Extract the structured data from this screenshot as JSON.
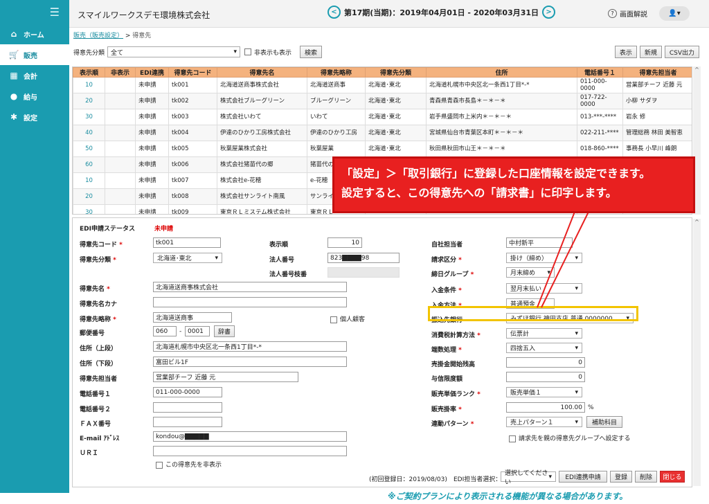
{
  "header": {
    "company": "スマイルワークスデモ環境株式会社",
    "period": "第17期(当期)：2019年04月01日 - 2020年03月31日",
    "help": "画面解説",
    "prev": "<",
    "next": ">"
  },
  "sidebar": {
    "items": [
      {
        "label": "ホーム",
        "icon": "home-icon"
      },
      {
        "label": "販売",
        "icon": "cart-icon"
      },
      {
        "label": "会計",
        "icon": "calculator-icon"
      },
      {
        "label": "給与",
        "icon": "moneybag-icon"
      },
      {
        "label": "設定",
        "icon": "gear-icon"
      }
    ]
  },
  "breadcrumb": {
    "parent": "販売（販売設定）",
    "current": "得意先"
  },
  "toolbar": {
    "category_label": "得意先分類",
    "category_value": "全て",
    "show_hidden": "非表示も表示",
    "search": "検索",
    "display": "表示",
    "new": "新規",
    "csv": "CSV出力"
  },
  "table": {
    "headers": [
      "表示順",
      "非表示",
      "EDI連携",
      "得意先コード",
      "得意先名",
      "得意先略称",
      "得意先分類",
      "住所",
      "電話番号１",
      "得意先担当者"
    ],
    "rows": [
      [
        "10",
        "",
        "未申請",
        "tk001",
        "北海道送商事株式会社",
        "北海道送商事",
        "北海道･東北",
        "北海道札幌市中央区北一条西1丁目*-*",
        "011-000-0000",
        "営業部チーフ 近藤 元"
      ],
      [
        "20",
        "",
        "未申請",
        "tk002",
        "株式会社ブルーグリーン",
        "ブルーグリーン",
        "北海道･東北",
        "青森県青森市長島＊－＊－＊",
        "017-722-0000",
        "小柳 サダヲ"
      ],
      [
        "30",
        "",
        "未申請",
        "tk003",
        "株式会社いわて",
        "いわて",
        "北海道･東北",
        "岩手県盛岡市上米内＊－＊－＊",
        "013-***-****",
        "岩永 修"
      ],
      [
        "40",
        "",
        "未申請",
        "tk004",
        "伊達のひかり工房株式会社",
        "伊達のひかり工房",
        "北海道･東北",
        "宮城県仙台市青葉区本町＊－＊－＊",
        "022-211-****",
        "管理総務 林田 美智恵"
      ],
      [
        "50",
        "",
        "未申請",
        "tk005",
        "秋葉屋業株式会社",
        "秋葉屋業",
        "北海道･東北",
        "秋田県秋田市山王＊－＊－＊",
        "018-860-****",
        "事務長 小早川 峰朗"
      ],
      [
        "60",
        "",
        "未申請",
        "tk006",
        "株式会社猪苗代の郷",
        "猪苗代の郷",
        "",
        "",
        "",
        ""
      ],
      [
        "10",
        "",
        "未申請",
        "tk007",
        "株式会社e-花穂",
        "e-花穂",
        "",
        "",
        "",
        ""
      ],
      [
        "20",
        "",
        "未申請",
        "tk008",
        "株式会社サンライト南風",
        "サンライト",
        "",
        "",
        "",
        ""
      ],
      [
        "30",
        "",
        "未申請",
        "tk009",
        "東京ＲＬミステム株式会社",
        "東京ＲＬ",
        "",
        "",
        "",
        ""
      ]
    ]
  },
  "callout": {
    "line1": "「設定」＞「取引銀行」に登録した口座情報を設定できます。",
    "line2": "設定すると、この得意先への「請求書」に印字します。"
  },
  "form": {
    "edi_status_label": "EDI申請ステータス",
    "edi_status_value": "未申請",
    "code_label": "得意先コード",
    "code_value": "tk001",
    "category_label": "得意先分類",
    "category_value": "北海道･東北",
    "order_label": "表示順",
    "order_value": "10",
    "corp_no_label": "法人番号",
    "corp_no_value": "823▇▇▇▇98",
    "corp_branch_label": "法人番号枝番",
    "name_label": "得意先名",
    "name_value": "北海道送商事株式会社",
    "kana_label": "得意先名カナ",
    "short_label": "得意先略称",
    "short_value": "北海道送商事",
    "individual_label": "個人顧客",
    "zip_label": "郵便番号",
    "zip1": "060",
    "zip2": "0001",
    "dict": "辞書",
    "addr1_label": "住所（上段）",
    "addr1_value": "北海道札幌市中央区北一条西1丁目*-*",
    "addr2_label": "住所（下段）",
    "addr2_value": "富田ビル1F",
    "person_label": "得意先担当者",
    "person_value": "営業部チーフ 近藤 元",
    "tel1_label": "電話番号１",
    "tel1_value": "011-000-0000",
    "tel2_label": "電話番号２",
    "fax_label": "ＦＡＸ番号",
    "email_label": "E-mail ｱﾄﾞﾚｽ",
    "email_value": "kondou@▇▇▇▇▇",
    "url_label": "ＵＲＩ",
    "hide_label": "この得意先を非表示",
    "staff_label": "自社担当者",
    "staff_value": "中村新平",
    "billing_label": "請求区分",
    "billing_value": "掛け（締め）",
    "close_label": "締日グループ",
    "close_value": "月末締め",
    "payment_label": "入金条件",
    "payment_value": "翌月末払い",
    "method_label": "入金方法",
    "method_value": "普通預金",
    "bank_label": "振込先銀行",
    "bank_value": "みずほ銀行 神田支店 普通 0000000",
    "tax_label": "消費税計算方法",
    "tax_value": "伝票計",
    "round_label": "端数処理",
    "round_value": "四捨五入",
    "receivable_label": "売掛金開始残高",
    "receivable_value": "0",
    "credit_label": "与信限度額",
    "credit_value": "0",
    "rank_label": "販売単価ランク",
    "rank_value": "販売単価１",
    "rate_label": "販売掛率",
    "rate_value": "100.00",
    "rate_unit": "%",
    "pattern_label": "連動パターン",
    "pattern_value": "売上パターン１",
    "aux": "補助科目",
    "parent_group_label": "請求先を親の得意先グループへ設定する",
    "registered": "(初回登録日：2019/08/03)",
    "edi_person_label": "EDI担当者選択：",
    "edi_person_value": "選択してください",
    "edi_apply": "EDI連携申請",
    "save": "登録",
    "delete": "削除",
    "close": "閉じる"
  },
  "note": "※ご契約プランにより表示される機能が異なる場合があります。",
  "colors": {
    "sidebar": "#1a9cb0",
    "table_header": "#f4b27e",
    "callout": "#e82020",
    "highlight": "#f2c400"
  }
}
